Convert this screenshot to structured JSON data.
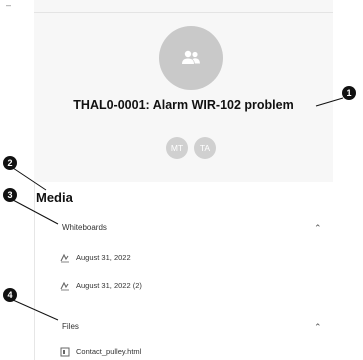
{
  "chat": {
    "title": "THAL0-0001: Alarm WIR-102 problem",
    "members": [
      "MT",
      "TA"
    ]
  },
  "callouts": [
    "1",
    "2",
    "3",
    "4"
  ],
  "media": {
    "heading": "Media",
    "whiteboards": {
      "label": "Whiteboards",
      "items": [
        "August 31, 2022",
        "August 31, 2022 (2)"
      ]
    },
    "files": {
      "label": "Files",
      "items": [
        "Contact_pulley.html"
      ]
    }
  },
  "icons": {
    "group_avatar": "group-icon",
    "whiteboard_item": "whiteboard-icon",
    "file_item": "file-icon",
    "section_toggle": "chevron-up-icon",
    "back": "back-icon"
  },
  "colors": {
    "avatar": "#c9c9c9",
    "header_bg": "#f7f7f7",
    "callout": "#111111"
  }
}
